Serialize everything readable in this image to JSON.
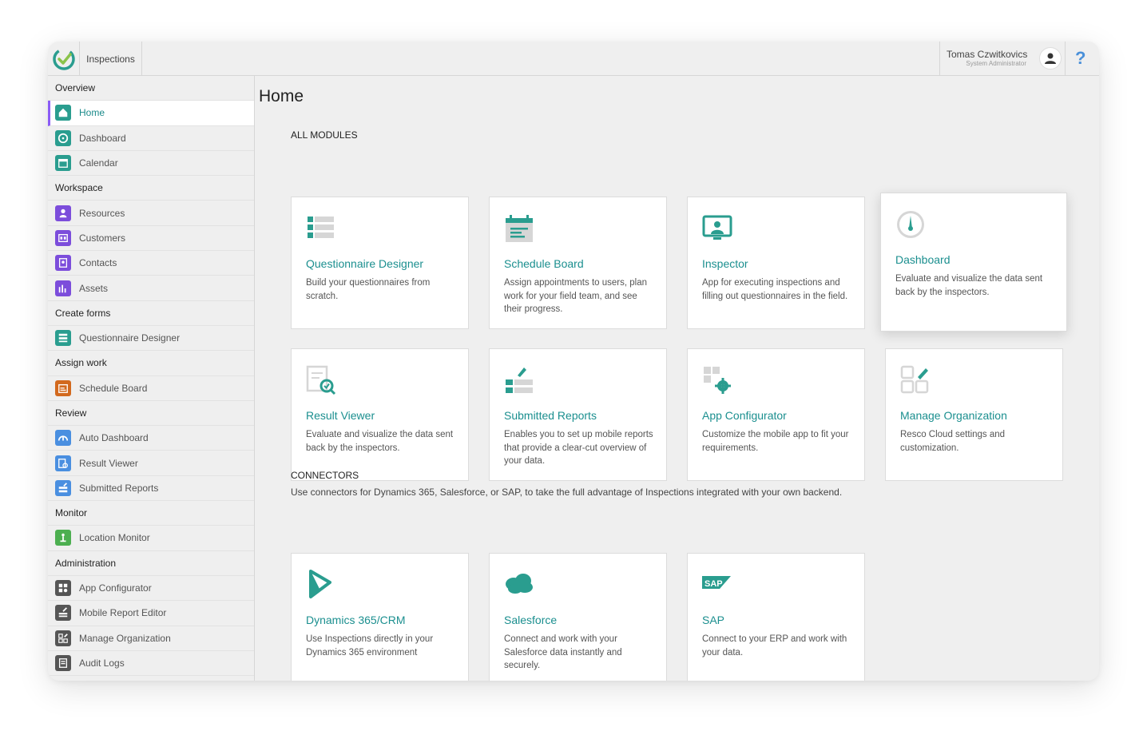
{
  "app": {
    "title": "Inspections"
  },
  "user": {
    "name": "Tomas Czwitkovics",
    "role": "System Administrator"
  },
  "help": {
    "label": "?"
  },
  "colors": {
    "accent": "#1b8f8f",
    "active_bar": "#8b5cf6",
    "help": "#4a90d9"
  },
  "sidebar": {
    "groups": [
      {
        "label": "Overview",
        "items": [
          {
            "label": "Home",
            "icon": "home-icon",
            "color": "#2a9d8f"
          },
          {
            "label": "Dashboard",
            "icon": "dashboard-icon",
            "color": "#2a9d8f"
          },
          {
            "label": "Calendar",
            "icon": "calendar-icon",
            "color": "#2a9d8f"
          }
        ]
      },
      {
        "label": "Workspace",
        "items": [
          {
            "label": "Resources",
            "icon": "resources-icon",
            "color": "#7c4ddb"
          },
          {
            "label": "Customers",
            "icon": "customers-icon",
            "color": "#7c4ddb"
          },
          {
            "label": "Contacts",
            "icon": "contacts-icon",
            "color": "#7c4ddb"
          },
          {
            "label": "Assets",
            "icon": "assets-icon",
            "color": "#7c4ddb"
          }
        ]
      },
      {
        "label": "Create forms",
        "items": [
          {
            "label": "Questionnaire Designer",
            "icon": "questionnaire-icon",
            "color": "#2a9d8f"
          }
        ]
      },
      {
        "label": "Assign work",
        "items": [
          {
            "label": "Schedule Board",
            "icon": "schedule-icon",
            "color": "#d2691e"
          }
        ]
      },
      {
        "label": "Review",
        "items": [
          {
            "label": "Auto Dashboard",
            "icon": "auto-dashboard-icon",
            "color": "#4a8fe0"
          },
          {
            "label": "Result Viewer",
            "icon": "result-viewer-icon",
            "color": "#4a8fe0"
          },
          {
            "label": "Submitted Reports",
            "icon": "reports-icon",
            "color": "#4a8fe0"
          }
        ]
      },
      {
        "label": "Monitor",
        "items": [
          {
            "label": "Location Monitor",
            "icon": "location-icon",
            "color": "#4caf50"
          }
        ]
      },
      {
        "label": "Administration",
        "items": [
          {
            "label": "App Configurator",
            "icon": "configurator-icon",
            "color": "#555555"
          },
          {
            "label": "Mobile Report Editor",
            "icon": "report-editor-icon",
            "color": "#555555"
          },
          {
            "label": "Manage Organization",
            "icon": "organization-icon",
            "color": "#555555"
          },
          {
            "label": "Audit Logs",
            "icon": "audit-icon",
            "color": "#555555"
          }
        ]
      }
    ]
  },
  "main": {
    "title": "Home",
    "modules_label": "ALL MODULES",
    "modules": [
      {
        "title": "Questionnaire Designer",
        "desc": "Build your questionnaires from scratch.",
        "icon": "questionnaire-icon"
      },
      {
        "title": "Schedule Board",
        "desc": "Assign appointments to users, plan work for your field team, and see their progress.",
        "icon": "schedule-icon"
      },
      {
        "title": "Inspector",
        "desc": "App for executing inspections and filling out questionnaires in the field.",
        "icon": "inspector-icon"
      },
      {
        "title": "Dashboard",
        "desc": "Evaluate and visualize the data sent back by the inspectors.",
        "icon": "dashboard-gauge-icon"
      },
      {
        "title": "Result Viewer",
        "desc": "Evaluate and visualize the data sent back by the inspectors.",
        "icon": "result-viewer-icon"
      },
      {
        "title": "Submitted Reports",
        "desc": "Enables you to set up mobile reports that provide a clear-cut overview of your data.",
        "icon": "reports-icon"
      },
      {
        "title": "App Configurator",
        "desc": "Customize the mobile app to fit your requirements.",
        "icon": "configurator-icon"
      },
      {
        "title": "Manage Organization",
        "desc": "Resco Cloud settings and customization.",
        "icon": "organization-icon"
      }
    ],
    "connectors_label": "CONNECTORS",
    "connectors_desc": "Use connectors for Dynamics 365, Salesforce, or SAP, to take the full advantage of Inspections integrated with your own backend.",
    "connectors": [
      {
        "title": "Dynamics 365/CRM",
        "desc": "Use Inspections directly in your Dynamics 365 environment",
        "icon": "dynamics-icon"
      },
      {
        "title": "Salesforce",
        "desc": "Connect and work with your Salesforce data instantly and securely.",
        "icon": "salesforce-icon"
      },
      {
        "title": "SAP",
        "desc": "Connect to your ERP and work with your data.",
        "icon": "sap-icon"
      }
    ]
  }
}
